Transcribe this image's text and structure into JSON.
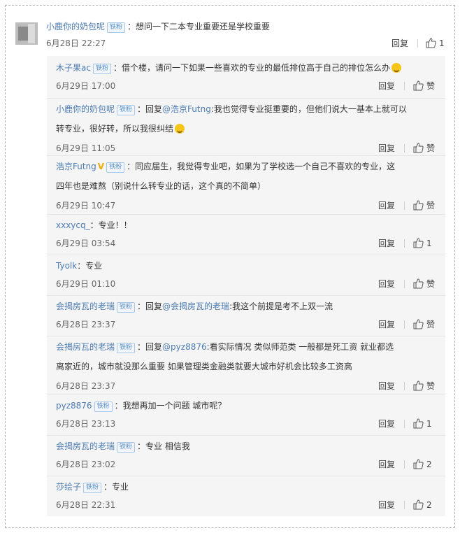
{
  "main_comment": {
    "user": "小鹿你的奶包呢",
    "badge": "铁粉",
    "text": "想问一下二本专业重要还是学校重要",
    "time": "6月28日 22:27",
    "reply_label": "回复",
    "likes": "1"
  },
  "replies": [
    {
      "user": "木子果ac",
      "badge": "铁粉",
      "line1": "：借个楼，请问一下如果一些喜欢的专业的最低排位高于自己的排位怎么办",
      "line2": "",
      "emoji": true,
      "time": "6月29日 17:00",
      "reply_label": "回复",
      "likes": "赞"
    },
    {
      "user": "小鹿你的奶包呢",
      "badge": "铁粉",
      "line1_prefix": "：回复",
      "mention": "@浩京Futng",
      "line1": ":我也觉得专业挺重要的，但他们说大一基本上就可以",
      "line2": "转专业，很好转，所以我很纠结",
      "emoji": true,
      "time": "6月29日 11:05",
      "reply_label": "回复",
      "likes": "赞"
    },
    {
      "user": "浩京Futng",
      "badge": "铁粉",
      "vbadge": "V",
      "line1": "：同应届生，我觉得专业吧，如果为了学校选一个自己不喜欢的专业，这",
      "line2": "四年也是难熬（别说什么转专业的话，这个真的不简单）",
      "time": "6月29日 10:47",
      "reply_label": "回复",
      "likes": "赞"
    },
    {
      "user": "xxxycq_",
      "badge": "",
      "line1": "：专业！！",
      "line2": "",
      "time": "6月29日 03:54",
      "reply_label": "回复",
      "likes": "1"
    },
    {
      "user": "Tyolk",
      "badge": "",
      "line1": "：专业",
      "line2": "",
      "time": "6月29日 01:10",
      "reply_label": "回复",
      "likes": "赞"
    },
    {
      "user": "会揭房瓦的老瑞",
      "badge": "铁粉",
      "line1_prefix": "：回复",
      "mention": "@会揭房瓦的老瑞",
      "line1": ":我这个前提是考不上双一流",
      "line2": "",
      "time": "6月28日 23:37",
      "reply_label": "回复",
      "likes": "赞"
    },
    {
      "user": "会揭房瓦的老瑞",
      "badge": "铁粉",
      "line1_prefix": "：回复",
      "mention": "@pyz8876",
      "line1": ":看实际情况  类似师范类     一般都是死工资  就业都选",
      "line2": "离家近的，城市就没那么重要   如果管理类金融类就要大城市好机会比较多工资高",
      "time": "6月28日 23:37",
      "reply_label": "回复",
      "likes": "赞"
    },
    {
      "user": "pyz8876",
      "badge": "铁粉",
      "line1": "：我想再加一个问题 城市呢？",
      "line2": "",
      "time": "6月28日 23:13",
      "reply_label": "回复",
      "likes": "1"
    },
    {
      "user": "会揭房瓦的老瑞",
      "badge": "铁粉",
      "line1": "：专业  相信我",
      "line2": "",
      "time": "6月28日 23:02",
      "reply_label": "回复",
      "likes": "2"
    },
    {
      "user": "莎绘子",
      "badge": "铁粉",
      "line1": "：专业",
      "line2": "",
      "time": "6月28日 22:31",
      "reply_label": "回复",
      "likes": "2"
    }
  ]
}
